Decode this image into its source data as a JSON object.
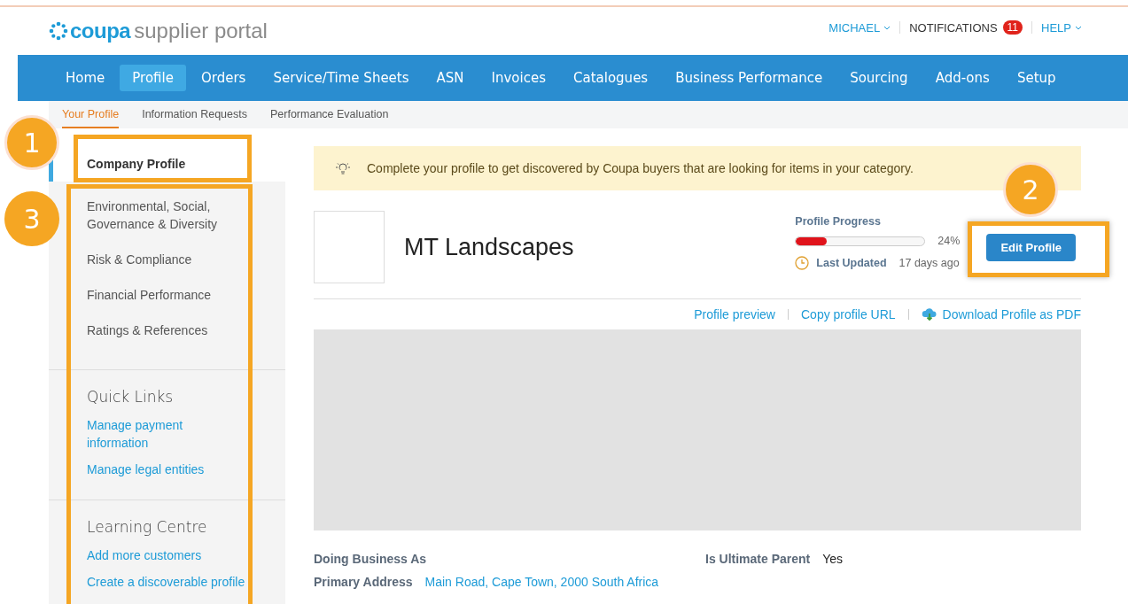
{
  "header": {
    "logo": {
      "brand": "coupa",
      "product": "supplier portal"
    },
    "user_menu": "MICHAEL",
    "notifications": {
      "label": "NOTIFICATIONS",
      "count": "11"
    },
    "help": "HELP"
  },
  "nav": [
    {
      "label": "Home",
      "selected": false
    },
    {
      "label": "Profile",
      "selected": true
    },
    {
      "label": "Orders",
      "selected": false
    },
    {
      "label": "Service/Time Sheets",
      "selected": false
    },
    {
      "label": "ASN",
      "selected": false
    },
    {
      "label": "Invoices",
      "selected": false
    },
    {
      "label": "Catalogues",
      "selected": false
    },
    {
      "label": "Business Performance",
      "selected": false
    },
    {
      "label": "Sourcing",
      "selected": false
    },
    {
      "label": "Add-ons",
      "selected": false
    },
    {
      "label": "Setup",
      "selected": false
    }
  ],
  "subnav": [
    {
      "label": "Your Profile",
      "selected": true
    },
    {
      "label": "Information Requests",
      "selected": false
    },
    {
      "label": "Performance Evaluation",
      "selected": false
    }
  ],
  "sidebar": {
    "items": [
      {
        "label": "Company Profile",
        "selected": true
      },
      {
        "label": "Environmental, Social, Governance & Diversity",
        "selected": false
      },
      {
        "label": "Risk & Compliance",
        "selected": false
      },
      {
        "label": "Financial Performance",
        "selected": false
      },
      {
        "label": "Ratings & References",
        "selected": false
      }
    ],
    "sections": [
      {
        "title": "Quick Links",
        "links": [
          "Manage payment information",
          "Manage legal entities"
        ]
      },
      {
        "title": "Learning Centre",
        "links": [
          "Add more customers",
          "Create a discoverable profile"
        ]
      }
    ]
  },
  "banner": {
    "text": "Complete your profile to get discovered by Coupa buyers that are looking for items in your category."
  },
  "profile": {
    "name": "MT Landscapes",
    "progress_label": "Profile Progress",
    "level": 0.24,
    "percent": "24%",
    "last_updated_label": "Last Updated",
    "last_updated": "17 days ago",
    "edit_button": "Edit Profile"
  },
  "links": [
    "Profile preview",
    "Copy profile URL",
    "Download Profile as PDF"
  ],
  "details": [
    {
      "label": "Doing Business As"
    },
    {
      "label": "Is Ultimate Parent",
      "value": "Yes",
      "kind": "text"
    },
    {
      "label": "Primary Address",
      "value": "Main Road, Cape Town, 2000 South Africa",
      "kind": "link"
    }
  ],
  "annotations": [
    {
      "label": "1"
    },
    {
      "label": "2"
    },
    {
      "label": "3"
    }
  ]
}
